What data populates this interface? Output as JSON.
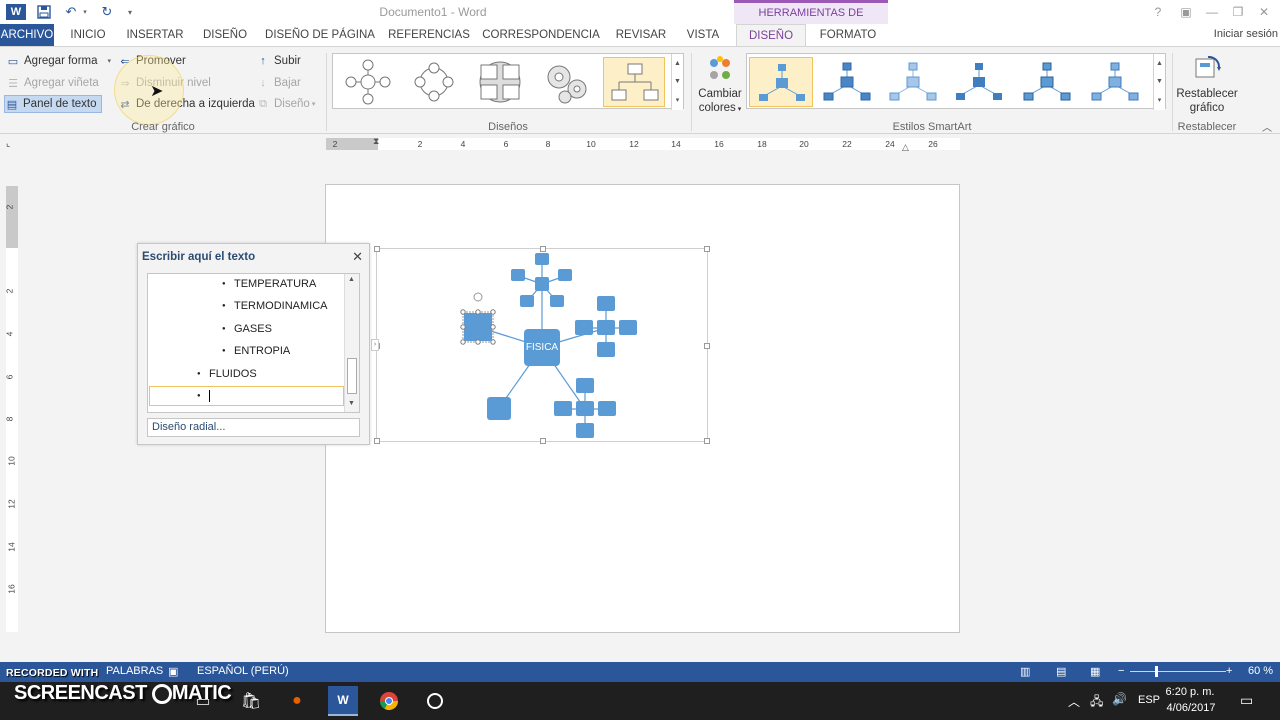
{
  "titlebar": {
    "doc_title": "Documento1 - Word",
    "context_header": "HERRAMIENTAS DE SMARTART"
  },
  "tabs": {
    "file": "ARCHIVO",
    "items": [
      "INICIO",
      "INSERTAR",
      "DISEÑO",
      "DISEÑO DE PÁGINA",
      "REFERENCIAS",
      "CORRESPONDENCIA",
      "REVISAR",
      "VISTA"
    ],
    "ctx_design": "DISEÑO",
    "ctx_format": "FORMATO",
    "signin": "Iniciar sesión"
  },
  "ribbon": {
    "crear": {
      "agregar_forma": "Agregar forma",
      "agregar_vineta": "Agregar viñeta",
      "panel_texto": "Panel de texto",
      "promover": "Promover",
      "disminuir": "Disminuir nivel",
      "derecha_izquierda": "De derecha a izquierda",
      "subir": "Subir",
      "bajar": "Bajar",
      "diseno": "Diseño",
      "label": "Crear gráfico"
    },
    "disenos_label": "Diseños",
    "cambiar_colores": [
      "Cambiar",
      "colores"
    ],
    "estilos_label": "Estilos SmartArt",
    "restablecer_grafico": [
      "Restablecer",
      "gráfico"
    ],
    "restablecer_label": "Restablecer"
  },
  "ruler": {
    "h_ticks": [
      "2",
      "2",
      "4",
      "6",
      "8",
      "10",
      "12",
      "14",
      "16",
      "18",
      "20",
      "22",
      "24",
      "26"
    ],
    "v_ticks": [
      "2",
      "2",
      "4",
      "6",
      "8",
      "10",
      "12",
      "14",
      "16"
    ]
  },
  "text_pane": {
    "title": "Escribir aquí el texto",
    "items": [
      {
        "level": 2,
        "text": "TEMPERATURA"
      },
      {
        "level": 2,
        "text": "TERMODINAMICA"
      },
      {
        "level": 2,
        "text": "GASES"
      },
      {
        "level": 2,
        "text": "ENTROPIA"
      },
      {
        "level": 1,
        "text": "FLUIDOS"
      },
      {
        "level": 1,
        "text": ""
      }
    ],
    "footer": "Diseño radial..."
  },
  "smartart": {
    "center": "FISICA"
  },
  "statusbar": {
    "words": "PALABRAS",
    "language": "ESPAÑOL (PERÚ)",
    "zoom": "60 %"
  },
  "watermark": {
    "small": "RECORDED WITH",
    "big": "SCREENCAST",
    "big2": "MATIC"
  },
  "taskbar": {
    "lang": "ESP",
    "time": "6:20 p. m.",
    "date": "4/06/2017"
  },
  "colors": {
    "word_blue": "#2b579a",
    "smartart_blue": "#5b9bd5",
    "context_purple": "#7b3f9e"
  }
}
